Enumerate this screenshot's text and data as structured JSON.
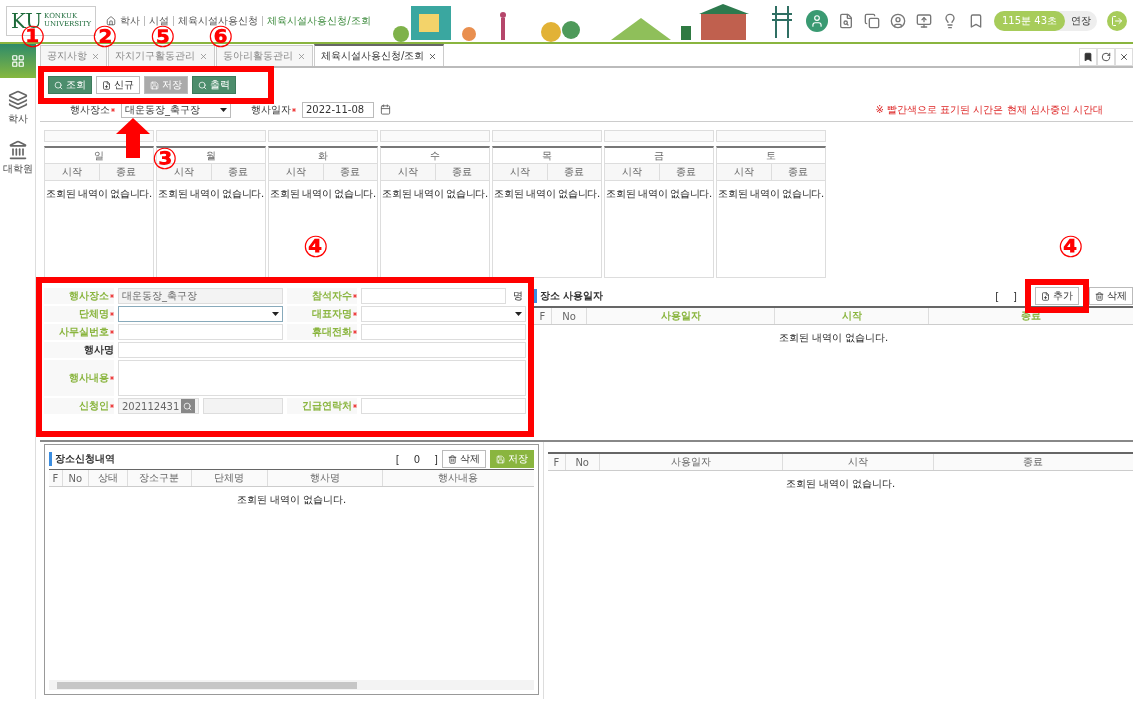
{
  "header": {
    "logo_mark": "KU",
    "logo_name": "KONKUK",
    "logo_sub": "UNIVERSITY",
    "breadcrumb": [
      "학사",
      "시설",
      "체육시설사용신청",
      "체육시설사용신청/조회"
    ],
    "timer": "115분 43초",
    "extend_button": "연장"
  },
  "sidebar": [
    {
      "kind": "grid",
      "selected": true
    },
    {
      "kind": "layers",
      "label": "학사",
      "selected": false
    },
    {
      "kind": "building",
      "label": "대학원",
      "selected": false
    }
  ],
  "tabs": [
    {
      "label": "공지사항",
      "selected": false
    },
    {
      "label": "자치기구활동관리",
      "selected": false
    },
    {
      "label": "동아리활동관리",
      "selected": false
    },
    {
      "label": "체육시설사용신청/조회",
      "selected": true
    }
  ],
  "toolbar": [
    {
      "kind": "search",
      "label": "조회",
      "disabled": false
    },
    {
      "kind": "new",
      "label": "신규",
      "disabled": false
    },
    {
      "kind": "save",
      "label": "저장",
      "disabled": true
    },
    {
      "kind": "print",
      "label": "출력",
      "disabled": false
    }
  ],
  "filters": {
    "place_label": "행사장소",
    "place_value": "대운동장_축구장",
    "date_label": "행사일자",
    "date_value": "2022-11-08",
    "notice": "※ 빨간색으로 표기된 시간은 현재 심사중인 시간대"
  },
  "week": [
    {
      "day": "일",
      "start": "시작",
      "end": "종료",
      "message": "조회된 내역이 없습니다."
    },
    {
      "day": "월",
      "start": "시작",
      "end": "종료",
      "message": "조회된 내역이 없습니다."
    },
    {
      "day": "화",
      "start": "시작",
      "end": "종료",
      "message": "조회된 내역이 없습니다."
    },
    {
      "day": "수",
      "start": "시작",
      "end": "종료",
      "message": "조회된 내역이 없습니다."
    },
    {
      "day": "목",
      "start": "시작",
      "end": "종료",
      "message": "조회된 내역이 없습니다."
    },
    {
      "day": "금",
      "start": "시작",
      "end": "종료",
      "message": "조회된 내역이 없습니다."
    },
    {
      "day": "토",
      "start": "시작",
      "end": "종료",
      "message": "조회된 내역이 없습니다."
    }
  ],
  "form": [
    {
      "fields": [
        {
          "kind": "text",
          "label": "행사장소",
          "required": true,
          "readonly": true,
          "value": "대운동장_축구장"
        },
        {
          "kind": "text",
          "label": "참석자수",
          "required": true,
          "readonly": false,
          "unit": "명"
        }
      ]
    },
    {
      "fields": [
        {
          "kind": "select",
          "label": "단체명",
          "required": true,
          "readonly": false
        },
        {
          "kind": "select",
          "label": "대표자명",
          "required": true,
          "readonly": false
        }
      ]
    },
    {
      "fields": [
        {
          "kind": "text",
          "label": "사무실번호",
          "required": true,
          "readonly": false
        },
        {
          "kind": "text",
          "label": "휴대전화",
          "required": true,
          "readonly": false
        }
      ]
    },
    {
      "fields": [
        {
          "kind": "text",
          "label": "행사명",
          "required": false,
          "readonly": false
        }
      ]
    },
    {
      "fields": [
        {
          "kind": "textarea",
          "label": "행사내용",
          "required": true,
          "readonly": false
        }
      ]
    },
    {
      "fields": [
        {
          "kind": "search",
          "label": "신청인",
          "required": true,
          "readonly": true,
          "value": "202112431"
        },
        {
          "kind": "text",
          "label": "긴급연락처",
          "required": true,
          "readonly": false
        }
      ]
    }
  ],
  "usage_dates": {
    "title": "장소 사용일자",
    "bracket_open": "[",
    "bracket_close": "]",
    "buttons": [
      {
        "kind": "add",
        "label": "추가"
      },
      {
        "kind": "delete",
        "label": "삭제"
      }
    ],
    "columns": [
      {
        "label": "F",
        "required": false
      },
      {
        "label": "No",
        "required": false
      },
      {
        "label": "사용일자",
        "required": true
      },
      {
        "label": "시작",
        "required": true
      },
      {
        "label": "종료",
        "required": true
      }
    ],
    "empty": "조회된 내역이 없습니다."
  },
  "applications": {
    "title": "장소신청내역",
    "bracket_open": "[",
    "count": "0",
    "bracket_close": "]",
    "buttons": [
      {
        "kind": "delete",
        "label": "삭제"
      },
      {
        "kind": "save",
        "label": "저장"
      }
    ],
    "columns": [
      {
        "label": "F",
        "required": false
      },
      {
        "label": "No",
        "required": false
      },
      {
        "label": "상태",
        "required": false
      },
      {
        "label": "장소구분",
        "required": false
      },
      {
        "label": "단체명",
        "required": false
      },
      {
        "label": "행사명",
        "required": false
      },
      {
        "label": "행사내용",
        "required": false
      }
    ],
    "empty": "조회된 내역이 없습니다."
  },
  "schedule_table": {
    "columns": [
      {
        "label": "F",
        "required": false
      },
      {
        "label": "No",
        "required": false
      },
      {
        "label": "사용일자",
        "required": false
      },
      {
        "label": "시작",
        "required": false
      },
      {
        "label": "종료",
        "required": false
      }
    ],
    "empty": "조회된 내역이 없습니다."
  },
  "annotations": [
    {
      "label": "①"
    },
    {
      "label": "②"
    },
    {
      "label": "⑤"
    },
    {
      "label": "⑥"
    },
    {
      "label": "③"
    },
    {
      "label": "④"
    },
    {
      "label": "④"
    }
  ]
}
